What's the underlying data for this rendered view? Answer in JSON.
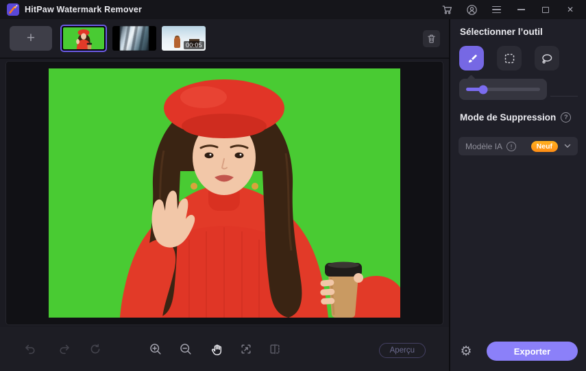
{
  "window": {
    "title": "HitPaw Watermark Remover"
  },
  "glyphs": {
    "add": "+",
    "close": "✕",
    "gear": "⚙",
    "question": "?",
    "info": "!"
  },
  "thumbnail_bar": {
    "items": [
      {
        "type": "image",
        "selected": true,
        "description": "green-screen portrait photo"
      },
      {
        "type": "image",
        "selected": false,
        "description": "blurred group photo"
      },
      {
        "type": "video",
        "selected": false,
        "description": "winter scene clip",
        "duration": "00:05"
      }
    ]
  },
  "sidebar": {
    "tool_section_title": "Sélectionner l’outil",
    "tools": [
      {
        "name": "brush",
        "active": true
      },
      {
        "name": "marquee",
        "active": false
      },
      {
        "name": "lasso",
        "active": false
      }
    ],
    "brush_size_percent": 23,
    "mode_section_title": "Mode de Suppression",
    "mode_dropdown": {
      "label": "Modèle IA",
      "badge": "Neuf"
    }
  },
  "bottom_toolbar": {
    "preview_label": "Aperçu"
  },
  "footer": {
    "export_label": "Exporter"
  },
  "colors": {
    "accent_purple": "#8b80f9",
    "tool_active_purple": "#7668e4",
    "selection_border_purple": "#6c5ce7",
    "badge_orange": "#ff9e1b",
    "chroma_green": "#49cb33"
  }
}
